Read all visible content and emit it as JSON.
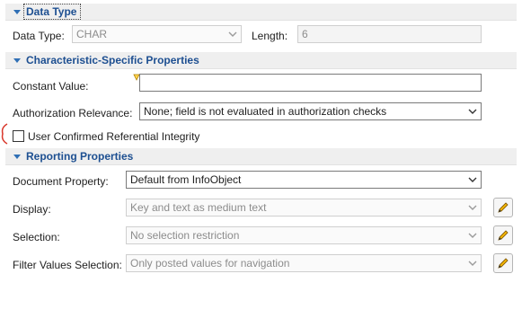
{
  "data_type_section": {
    "title": "Data Type",
    "data_type_label": "Data Type:",
    "data_type_value": "CHAR",
    "length_label": "Length:",
    "length_value": "6"
  },
  "characteristic_section": {
    "title": "Characteristic-Specific Properties",
    "constant_value_label": "Constant Value:",
    "constant_value": "",
    "authorization_label": "Authorization Relevance:",
    "authorization_value": "None; field is not evaluated in authorization checks",
    "referential_integrity_label": "User Confirmed Referential Integrity",
    "referential_integrity_checked": false
  },
  "reporting_section": {
    "title": "Reporting Properties",
    "document_property_label": "Document Property:",
    "document_property_value": "Default from InfoObject",
    "display_label": "Display:",
    "display_value": "Key and text as medium text",
    "selection_label": "Selection:",
    "selection_value": "No selection restriction",
    "filter_label": "Filter Values Selection:",
    "filter_value": "Only posted values for navigation"
  },
  "colors": {
    "section_title": "#1d4f91",
    "section_bg": "#efefef",
    "annotation_mark": "#d9382c",
    "edit_pencil": "#e0a000"
  }
}
